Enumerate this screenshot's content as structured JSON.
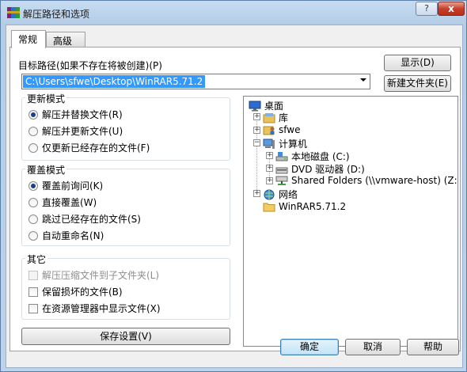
{
  "window": {
    "title": "解压路径和选项",
    "help_btn": "?",
    "close_btn": "x"
  },
  "tabs": [
    {
      "label": "常规",
      "active": true
    },
    {
      "label": "高级",
      "active": false
    }
  ],
  "dest": {
    "label": "目标路径(如果不存在将被创建)(P)",
    "value": "C:\\Users\\sfwe\\Desktop\\WinRAR5.71.2"
  },
  "buttons": {
    "show": "显示(D)",
    "new_folder": "新建文件夹(E)",
    "save_settings": "保存设置(V)",
    "ok": "确定",
    "cancel": "取消",
    "help": "帮助"
  },
  "update_mode": {
    "title": "更新模式",
    "options": [
      {
        "label": "解压并替换文件(R)",
        "checked": true
      },
      {
        "label": "解压并更新文件(U)",
        "checked": false
      },
      {
        "label": "仅更新已经存在的文件(F)",
        "checked": false
      }
    ]
  },
  "overwrite_mode": {
    "title": "覆盖模式",
    "options": [
      {
        "label": "覆盖前询问(K)",
        "checked": true
      },
      {
        "label": "直接覆盖(W)",
        "checked": false
      },
      {
        "label": "跳过已经存在的文件(S)",
        "checked": false
      },
      {
        "label": "自动重命名(N)",
        "checked": false
      }
    ]
  },
  "misc": {
    "title": "其它",
    "options": [
      {
        "label": "解压压缩文件到子文件夹(L)",
        "checked": false,
        "disabled": true
      },
      {
        "label": "保留损坏的文件(B)",
        "checked": false,
        "disabled": false
      },
      {
        "label": "在资源管理器中显示文件(X)",
        "checked": false,
        "disabled": false
      }
    ]
  },
  "tree": [
    {
      "label": "桌面",
      "icon": "desktop-icon"
    },
    {
      "label": "库",
      "icon": "library-icon"
    },
    {
      "label": "sfwe",
      "icon": "user-folder-icon"
    },
    {
      "label": "计算机",
      "icon": "computer-icon"
    },
    {
      "label": "本地磁盘 (C:)",
      "icon": "hard-disk-icon"
    },
    {
      "label": "DVD 驱动器 (D:)",
      "icon": "dvd-drive-icon"
    },
    {
      "label": "Shared Folders (\\\\vmware-host) (Z:)",
      "icon": "network-drive-icon"
    },
    {
      "label": "网络",
      "icon": "network-icon"
    },
    {
      "label": "WinRAR5.71.2",
      "icon": "folder-icon"
    }
  ],
  "colors": {
    "selection": "#3399ff",
    "close_red": "#c7402b",
    "title_bg": "#bcd3ea"
  }
}
